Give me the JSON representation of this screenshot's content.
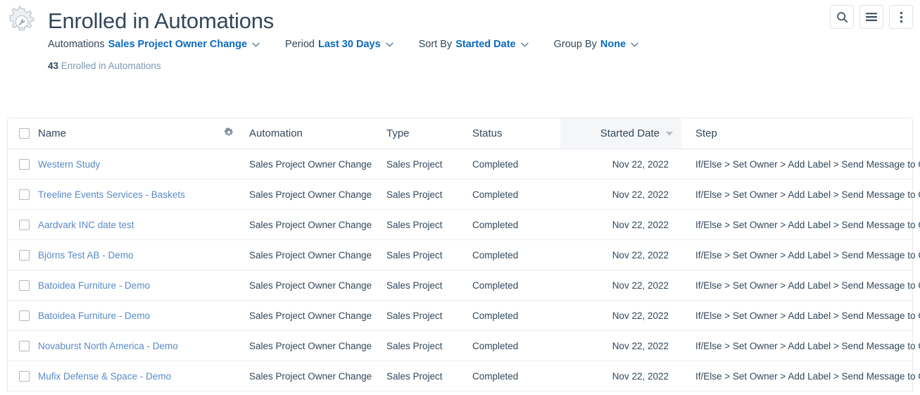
{
  "header": {
    "icon": "gear-wrench-icon",
    "title": "Enrolled in Automations",
    "filters": [
      {
        "label": "Automations",
        "value": "Sales Project Owner Change"
      },
      {
        "label": "Period",
        "value": "Last 30 Days"
      },
      {
        "label": "Sort By",
        "value": "Started Date"
      },
      {
        "label": "Group By",
        "value": "None"
      }
    ],
    "count": "43",
    "count_label": "Enrolled in Automations",
    "actions": [
      {
        "name": "search-button",
        "icon": "search-icon"
      },
      {
        "name": "menu-button",
        "icon": "hamburger-icon"
      },
      {
        "name": "more-options-button",
        "icon": "vertical-dots-icon"
      }
    ]
  },
  "table": {
    "columns": [
      {
        "key": "name",
        "label": "Name"
      },
      {
        "key": "gear",
        "label": ""
      },
      {
        "key": "automation",
        "label": "Automation"
      },
      {
        "key": "type",
        "label": "Type"
      },
      {
        "key": "status",
        "label": "Status"
      },
      {
        "key": "started_date",
        "label": "Started Date",
        "sorted": true,
        "sort_direction": "desc"
      },
      {
        "key": "step",
        "label": "Step"
      }
    ],
    "rows": [
      {
        "name": "Western Study",
        "automation": "Sales Project Owner Change",
        "type": "Sales Project",
        "status": "Completed",
        "started_date": "Nov 22, 2022",
        "step": "If/Else > Set Owner > Add Label > Send Message to Gu"
      },
      {
        "name": "Treeline Events Services - Baskets",
        "automation": "Sales Project Owner Change",
        "type": "Sales Project",
        "status": "Completed",
        "started_date": "Nov 22, 2022",
        "step": "If/Else > Set Owner > Add Label > Send Message to Gu"
      },
      {
        "name": "Aardvark INC date test",
        "automation": "Sales Project Owner Change",
        "type": "Sales Project",
        "status": "Completed",
        "started_date": "Nov 22, 2022",
        "step": "If/Else > Set Owner > Add Label > Send Message to Gu"
      },
      {
        "name": "Björns Test AB - Demo",
        "automation": "Sales Project Owner Change",
        "type": "Sales Project",
        "status": "Completed",
        "started_date": "Nov 22, 2022",
        "step": "If/Else > Set Owner > Add Label > Send Message to Gu"
      },
      {
        "name": "Batoidea Furniture - Demo",
        "automation": "Sales Project Owner Change",
        "type": "Sales Project",
        "status": "Completed",
        "started_date": "Nov 22, 2022",
        "step": "If/Else > Set Owner > Add Label > Send Message to Gu"
      },
      {
        "name": "Batoidea Furniture - Demo",
        "automation": "Sales Project Owner Change",
        "type": "Sales Project",
        "status": "Completed",
        "started_date": "Nov 22, 2022",
        "step": "If/Else > Set Owner > Add Label > Send Message to Gu"
      },
      {
        "name": "Novaburst North America - Demo",
        "automation": "Sales Project Owner Change",
        "type": "Sales Project",
        "status": "Completed",
        "started_date": "Nov 22, 2022",
        "step": "If/Else > Set Owner > Add Label > Send Message to Gu"
      },
      {
        "name": "Mufix Defense & Space - Demo",
        "automation": "Sales Project Owner Change",
        "type": "Sales Project",
        "status": "Completed",
        "started_date": "Nov 22, 2022",
        "step": "If/Else > Set Owner > Add Label > Send Message to Gu"
      }
    ]
  },
  "colors": {
    "link": "#5a8ac6",
    "filter_link": "#0b6abf",
    "text": "#33475b",
    "muted": "#7c98b6",
    "border": "#e5e8ed",
    "sorted_header_bg": "#f5f6f8"
  }
}
